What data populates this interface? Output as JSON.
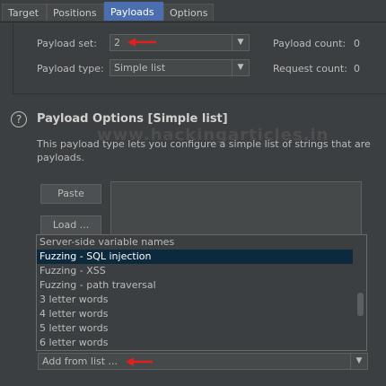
{
  "tabs": [
    {
      "label": "Target"
    },
    {
      "label": "Positions"
    },
    {
      "label": "Payloads"
    },
    {
      "label": "Options"
    }
  ],
  "payload_set": {
    "label": "Payload set:",
    "value": "2"
  },
  "payload_type": {
    "label": "Payload type:",
    "value": "Simple list"
  },
  "payload_count": {
    "label": "Payload count:",
    "value": "0"
  },
  "request_count": {
    "label": "Request count:",
    "value": "0"
  },
  "options": {
    "help_icon": "?",
    "title": "Payload Options [Simple list]",
    "description_line1": "This payload type lets you configure a simple list of strings that are",
    "description_line2": "payloads.",
    "watermark": "www.hackingarticles.in"
  },
  "buttons": {
    "paste": "Paste",
    "load": "Load ..."
  },
  "dropdown": {
    "items": [
      "Server-side variable names",
      "Fuzzing - SQL injection",
      "Fuzzing - XSS",
      "Fuzzing - path traversal",
      "3 letter words",
      "4 letter words",
      "5 letter words",
      "6 letter words"
    ],
    "selected_index": 1
  },
  "add_from_list": {
    "value": "Add from list ..."
  },
  "colors": {
    "accent": "#4b6eaf",
    "annotation_arrow": "#e0201a",
    "selection": "#0d293e"
  }
}
